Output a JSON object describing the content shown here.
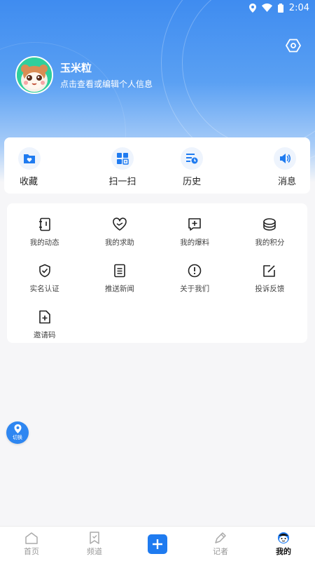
{
  "status_bar": {
    "time": "2:04"
  },
  "profile": {
    "name": "玉米粒",
    "subtitle": "点击查看或编辑个人信息"
  },
  "quick_actions": [
    {
      "label": "收藏",
      "icon": "favorite-folder-icon"
    },
    {
      "label": "扫一扫",
      "icon": "scan-icon"
    },
    {
      "label": "历史",
      "icon": "history-icon"
    },
    {
      "label": "消息",
      "icon": "speaker-icon"
    }
  ],
  "menu_items": [
    {
      "label": "我的动态",
      "icon": "notebook-icon"
    },
    {
      "label": "我的求助",
      "icon": "heart-icon"
    },
    {
      "label": "我的爆料",
      "icon": "add-box-icon"
    },
    {
      "label": "我的积分",
      "icon": "coins-icon"
    },
    {
      "label": "实名认证",
      "icon": "shield-check-icon"
    },
    {
      "label": "推送新闻",
      "icon": "document-icon"
    },
    {
      "label": "关于我们",
      "icon": "info-icon"
    },
    {
      "label": "投诉反馈",
      "icon": "edit-icon"
    },
    {
      "label": "邀请码",
      "icon": "file-plus-icon"
    }
  ],
  "switch_button": {
    "label": "切换"
  },
  "tabs": [
    {
      "label": "首页",
      "icon": "home-icon",
      "active": false
    },
    {
      "label": "频道",
      "icon": "bookmark-icon",
      "active": false
    },
    {
      "label": "",
      "icon": "add-icon",
      "active": false
    },
    {
      "label": "记者",
      "icon": "pen-icon",
      "active": false
    },
    {
      "label": "我的",
      "icon": "face-icon",
      "active": true
    }
  ],
  "colors": {
    "accent": "#1f7bf0",
    "header_top": "#3f8cf0",
    "icon_bg": "#eef4fd"
  }
}
